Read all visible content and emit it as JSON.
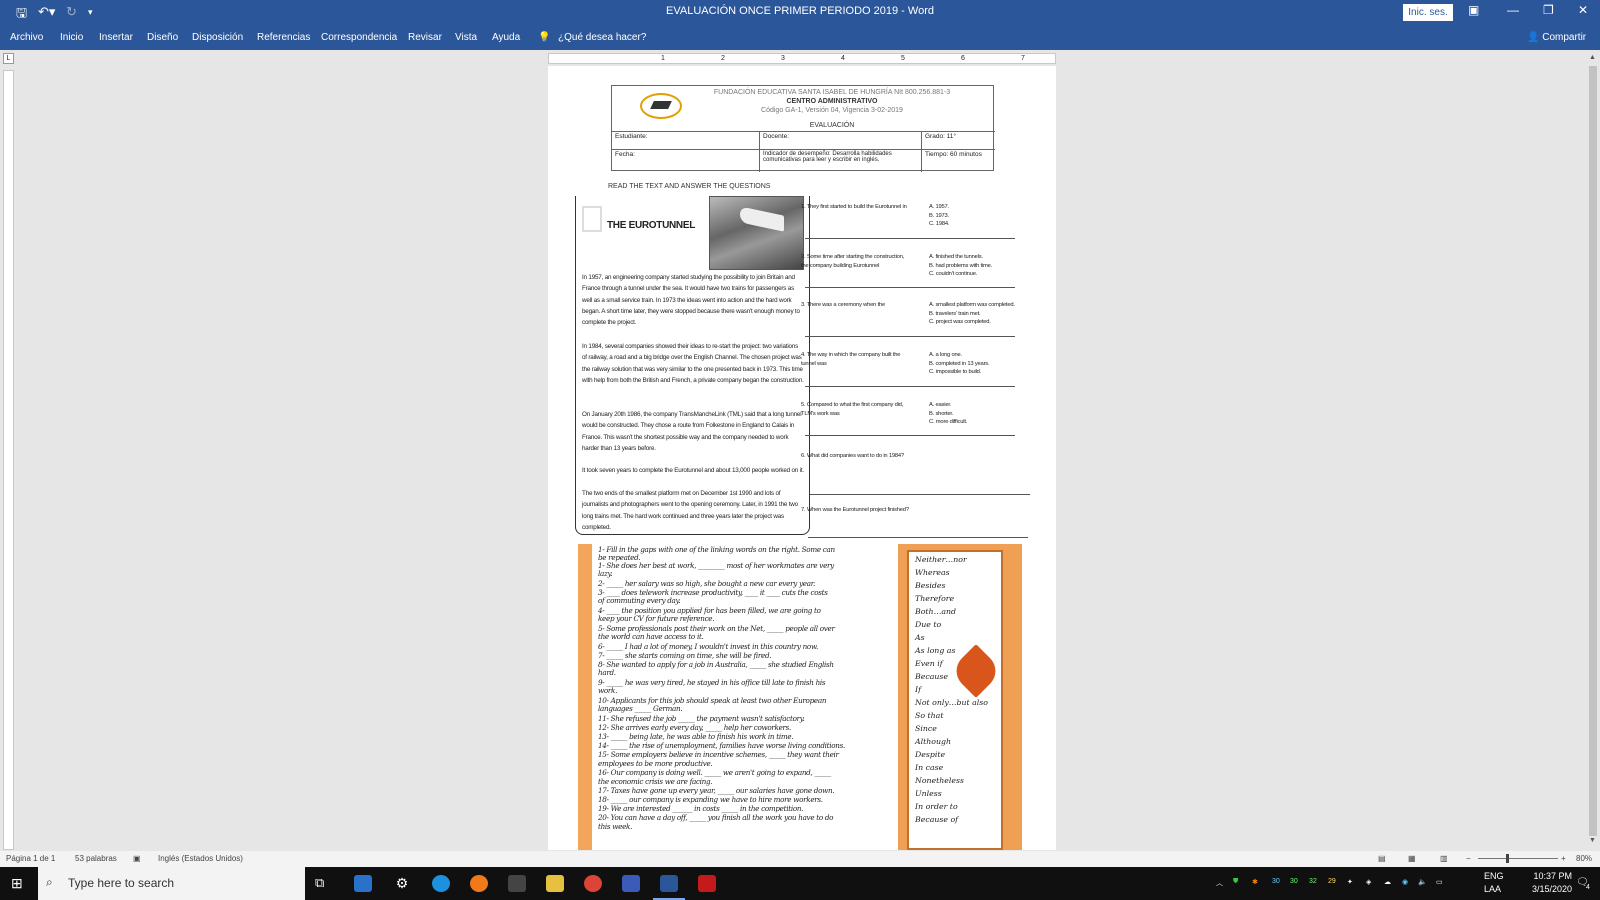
{
  "title_bar": {
    "title": "EVALUACIÓN ONCE PRIMER PERIODO 2019  -  Word",
    "sign_in": "Inic. ses."
  },
  "menu": [
    "Archivo",
    "Inicio",
    "Insertar",
    "Diseño",
    "Disposición",
    "Referencias",
    "Correspondencia",
    "Revisar",
    "Vista",
    "Ayuda"
  ],
  "tell_me": "¿Qué desea hacer?",
  "share": "Compartir",
  "ruler_marks": [
    "1",
    "2",
    "3",
    "4",
    "5",
    "6",
    "7"
  ],
  "doc": {
    "school": "FUNDACIÓN EDUCATIVA SANTA ISABEL DE HUNGRÍA NIt 800.256.881-3",
    "center": "CENTRO ADMINISTRATIVO",
    "code": "Código GA-1, Versión 04, Vigencia 3-02-2019",
    "eval": "EVALUACIÓN",
    "estudiante": "Estudiante:",
    "docente": "Docente:",
    "grado": "Grado: 11°",
    "fecha": "Fecha:",
    "indicador": "Indicador de desempeño: Desarrolla habilidades comunicativas para leer y escribir en inglés.",
    "tiempo": "Tiempo: 60 minutos",
    "instruction": "READ THE TEXT AND ANSWER THE QUESTIONS",
    "passage_title": "THE EUROTUNNEL",
    "paragraphs": [
      "In 1957, an engineering company started studying the possibility to join Britain and France through a tunnel under the sea. It would have two trains for passengers as well as a small service train. In 1973 the ideas went into action and the hard work began. A short time later, they were stopped because there wasn't enough money to complete the project.",
      "In 1984, several companies showed their ideas to re-start the project: two variations of railway, a road and a big bridge over the English Channel. The chosen project was the railway solution that was very similar to the one presented back in 1973. This time with help from both the British and French, a private company began the construction.",
      "On January 20th 1986, the company TransMancheLink (TML) said that a long tunnel would be constructed. They chose a route from Folkestone in England to Calais in France. This wasn't the shortest possible way and the company needed to work harder than 13 years before.",
      "It took seven years to complete the Eurotunnel and about 13,000 people worked on it.",
      "The two ends of the smallest platform met on December 1st 1990 and lots of journalists and photographers went to the opening ceremony. Later, in 1991 the two long trains met. The hard work continued and three years later the project was completed."
    ],
    "questions": [
      {
        "stem": "1. They first started to build the Eurotunnel in",
        "opts": [
          "A.   1957.",
          "B.   1973.",
          "C.   1984."
        ]
      },
      {
        "stem": "2. Some time after starting the construction, the company building Eurotunnel",
        "opts": [
          "A.   finished the tunnels.",
          "B.   had problems with time.",
          "C.   couldn't continue."
        ]
      },
      {
        "stem": "3. There was a ceremony when the",
        "opts": [
          "A.   smallest platform was completed.",
          "B.   travelers' train met.",
          "C.   project was completed."
        ]
      },
      {
        "stem": "4. The way in which the company built the tunnel was",
        "opts": [
          "A.   a long one.",
          "B.   completed in 13 years.",
          "C.   impossible to build."
        ]
      },
      {
        "stem": "5. Compared to what the first company did, TLM's work was",
        "opts": [
          "A.   easier.",
          "B.   shorter.",
          "C.   more difficult."
        ]
      },
      {
        "stem": "6. What did companies want to do in 1984?",
        "opts": []
      },
      {
        "stem": "7. When was the Eurotunnel project finished?",
        "opts": []
      }
    ],
    "exercise": [
      "1-   Fill in the gaps with one of the linking words on the right. Some can",
      "       be repeated.",
      "1-  She does her best at work, ________ most of her workmates are very",
      "      lazy.",
      "2-  _____ her salary was so high, she bought a new car every year.",
      "3-  ____ does telework increase productivity, ____ it ____ cuts the costs",
      "      of commuting every day.",
      "4-  ____ the position you applied for has been filled, we are going to",
      "      keep your CV for future reference.",
      "5-  Some professionals post their work on the Net, _____ people all over",
      "      the world can have access to it.",
      "6-  _____ I had a lot of money, I wouldn't invest in this country now.",
      "7-  _____ she starts coming on time, she will be fired.",
      "8-  She wanted to apply for a job in Australia, _____ she studied English",
      "      hard.",
      "9-  _____ he was very tired, he stayed in his office till late to finish his",
      "      work.",
      "10- Applicants for this job should speak at least two other European",
      "      languages _____ German.",
      "11- She refused the job _____ the payment wasn't satisfactory.",
      "12- She arrives early every day, _____ help her coworkers.",
      "13-  _____ being late, he was able to finish his work in time.",
      "14-  _____ the rise of unemployment, families have worse living conditions.",
      "15- Some employers believe in incentive schemes, _____ they want their",
      "      employees to be more productive.",
      "16- Our company is doing well. _____ we aren't going to expand, _____",
      "      the economic crisis we are facing.",
      "17- Taxes have gone up every year, _____ our salaries have gone down.",
      "18-  _____ our company is expanding we have to hire more workers.",
      "19- We are interested ______ in costs _____ in the competition.",
      "20- You can have a day off, _____ you finish all the work you have to do",
      "      this week."
    ],
    "linking_words": [
      "Neither…nor",
      "Whereas",
      "Besides",
      "Therefore",
      "Both…and",
      "Due to",
      "As",
      "As long as",
      "Even if",
      "Because",
      "If",
      "Not only…but also",
      "So that",
      "Since",
      "Although",
      "Despite",
      "In case",
      "Nonetheless",
      "Unless",
      "In order to",
      "Because of"
    ]
  },
  "status": {
    "page": "Página 1 de 1",
    "words": "53 palabras",
    "language": "Inglés (Estados Unidos)",
    "zoom": "80%"
  },
  "taskbar": {
    "search_placeholder": "Type here to search",
    "lang1": "ENG",
    "lang2": "LAA",
    "time": "10:37 PM",
    "date": "3/15/2020",
    "notif": "4",
    "tray_nums": [
      "30",
      "30",
      "32",
      "29"
    ]
  }
}
